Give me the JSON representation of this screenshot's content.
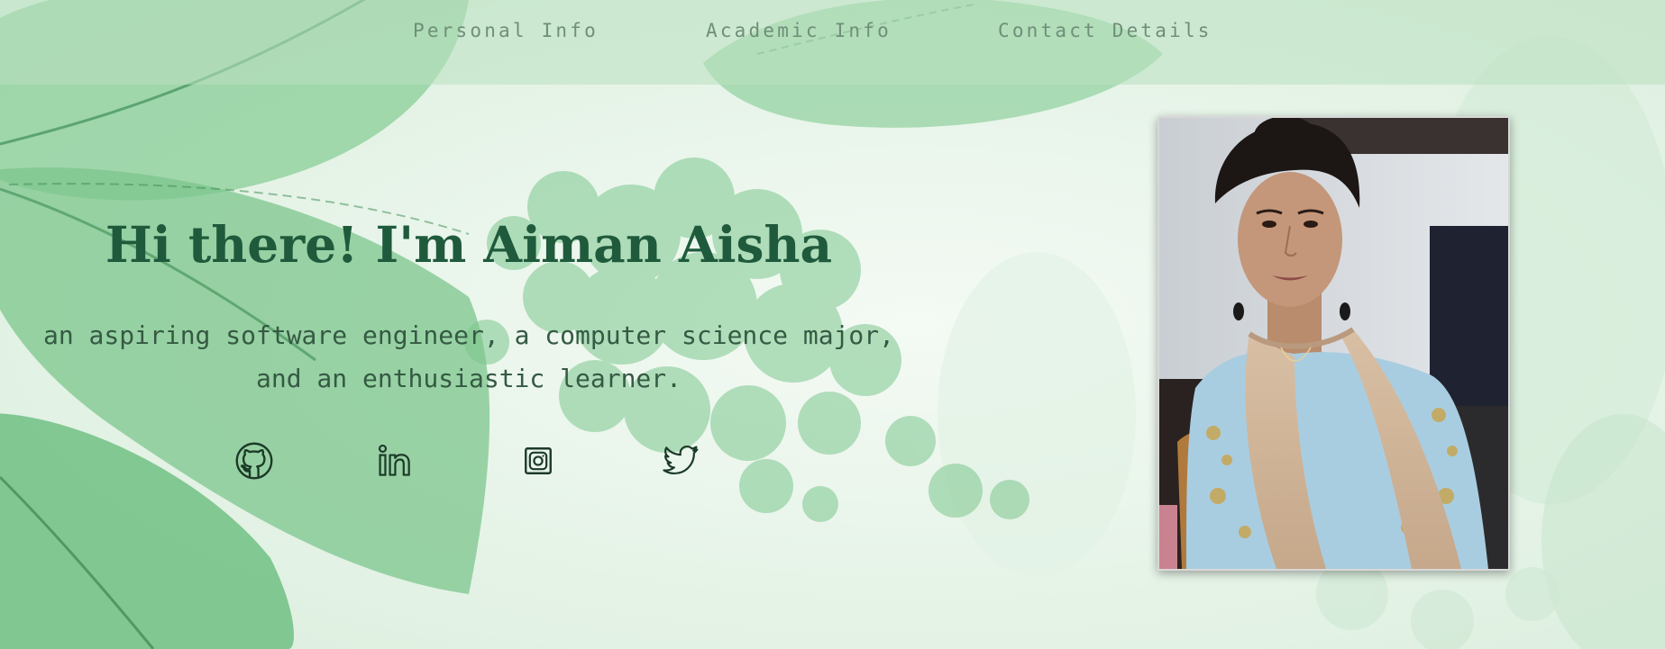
{
  "nav": {
    "items": [
      {
        "label": "Personal Info"
      },
      {
        "label": "Academic Info"
      },
      {
        "label": "Contact Details"
      }
    ]
  },
  "hero": {
    "title": "Hi there! I'm Aiman Aisha",
    "subtitle_line1": "an aspiring software engineer, a computer science major,",
    "subtitle_line2": "and an enthusiastic learner."
  },
  "social": [
    {
      "icon": "github-icon"
    },
    {
      "icon": "linkedin-icon"
    },
    {
      "icon": "instagram-icon"
    },
    {
      "icon": "twitter-icon"
    }
  ],
  "profile_photo": {
    "alt": "profile photo"
  },
  "colors": {
    "title": "#1f5a3c",
    "subtitle": "#355a43",
    "nav_text": "#6f8f78",
    "nav_bg": "#bae0c0",
    "background": "#eaf5ec",
    "leaf": "#5fb877"
  }
}
